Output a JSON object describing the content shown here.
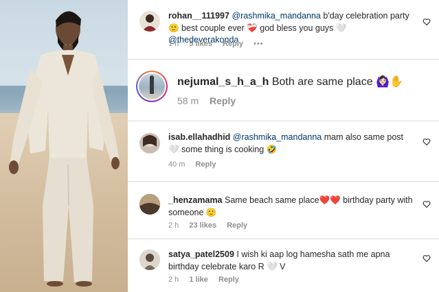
{
  "photo": {
    "description_icon": "photo-image"
  },
  "comments": [
    {
      "username": "rohan__111997",
      "mention": "@rashmika_mandanna",
      "text": " b'day celebration party 🙂 best couple ever ❤️‍🩹 god bless you guys 🤍",
      "mention2": "@thedeverakonda",
      "time": "1 h",
      "likes": "5 likes",
      "reply": "Reply",
      "more": "•••"
    },
    {
      "username": "nejumal_s_h_a_h",
      "text": " Both are same place 🙆🏻‍♀️✋",
      "time": "58 m",
      "reply": "Reply"
    },
    {
      "username": "isab.ellahadhid",
      "mention": "@rashmika_mandanna",
      "text": " mam also same post 🤍 some thing is cooking 🤣",
      "time": "40 m",
      "reply": "Reply"
    },
    {
      "username": "_henzamama",
      "text": " Same beach same place❤️❤️ birthday party with someone 🙂",
      "time": "2 h",
      "likes": "23 likes",
      "reply": "Reply"
    },
    {
      "username": "satya_patel2509",
      "text": " I wish ki aap log hamesha sath me apna birthday celebrate karo R 🤍 V",
      "time": "2 h",
      "likes": "1 like",
      "reply": "Reply"
    }
  ],
  "colors": {
    "mention": "#00376b",
    "meta": "#8e8e8e",
    "divider": "#dbdbdb"
  }
}
